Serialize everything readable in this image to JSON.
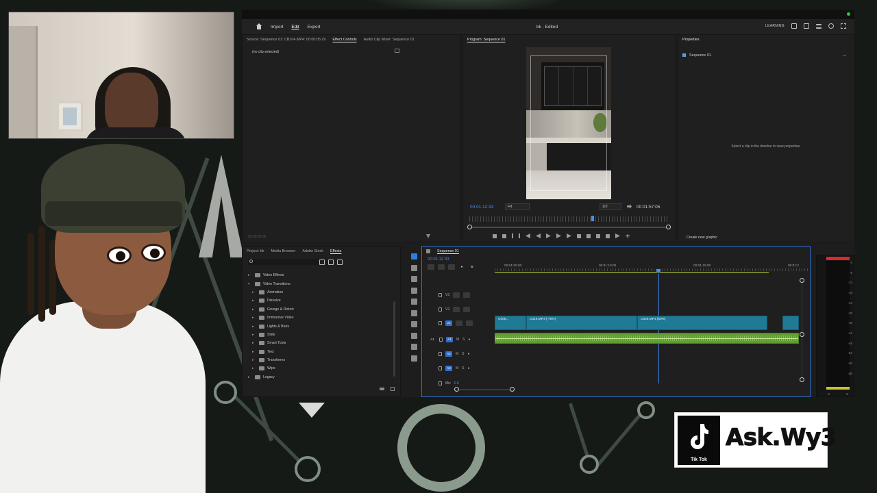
{
  "colors": {
    "accent": "#2d7de0",
    "video_clip": "#1f7a96",
    "audio_clip": "#5e9f2b",
    "timecode": "#4a8fe6",
    "meter_peak": "#e0262a"
  },
  "menubar": {
    "workspaces": [
      "Import",
      "Edit",
      "Export"
    ],
    "active_workspace": "Edit",
    "document_title": "bk - Edited",
    "learning_label": "LEARNING"
  },
  "source_panel": {
    "tabs": [
      "Source: Sequence 01: CB104.MP4: 00:00:05:29",
      "Effect Controls",
      "Audio Clip Mixer: Sequence 01"
    ],
    "active_tab": "Effect Controls",
    "empty_text": "(no clip selected)",
    "footer_timecode": "00:00:00:00"
  },
  "program_panel": {
    "tab": "Program: Sequence 01",
    "current_timecode": "00:01:12:33",
    "fit_option": "Fit",
    "resolution_option": "1/2",
    "duration_timecode": "00:01:57:05"
  },
  "properties_panel": {
    "tab": "Properties",
    "sequence_name": "Sequence 01",
    "hint": "Select a clip in the timeline to view properties.",
    "create_graphic_label": "Create new graphic"
  },
  "project_panel": {
    "tabs": [
      "Project: bk",
      "Media Browser",
      "Adobe Stock",
      "Effects"
    ],
    "active_tab": "Effects",
    "tree": [
      {
        "label": "Video Effects",
        "level": 0,
        "open": false
      },
      {
        "label": "Video Transitions",
        "level": 0,
        "open": true
      },
      {
        "label": "Animation",
        "level": 1
      },
      {
        "label": "Dissolve",
        "level": 1
      },
      {
        "label": "Grunge & Distort",
        "level": 1
      },
      {
        "label": "Immersive Video",
        "level": 1
      },
      {
        "label": "Lights & Blurs",
        "level": 1
      },
      {
        "label": "Slide",
        "level": 1
      },
      {
        "label": "Smart Tools",
        "level": 1
      },
      {
        "label": "Text",
        "level": 1
      },
      {
        "label": "Transforms",
        "level": 1
      },
      {
        "label": "Wipe",
        "level": 1
      },
      {
        "label": "Legacy",
        "level": 0
      }
    ]
  },
  "timeline": {
    "tab": "Sequence 01",
    "timecode": "00:01:12:33",
    "ruler_labels": [
      "00:01:05:00",
      "00:01:10:00",
      "00:01:15:00",
      "00:01:2"
    ],
    "tracks": [
      {
        "id": "V3",
        "type": "video"
      },
      {
        "id": "V2",
        "type": "video"
      },
      {
        "id": "V1",
        "type": "video"
      },
      {
        "id": "A1",
        "type": "audio"
      },
      {
        "id": "A2",
        "type": "audio"
      },
      {
        "id": "A3",
        "type": "audio"
      }
    ],
    "mix_label": "Mix",
    "mix_value": "0.0",
    "clips": [
      {
        "label": "C008...",
        "track": "V1"
      },
      {
        "label": "C016.MP4 [-75%]",
        "track": "V1"
      },
      {
        "label": "C028.MP4 [60%]",
        "track": "V1"
      }
    ]
  },
  "meter": {
    "scale": [
      "0",
      "-6",
      "-12",
      "-18",
      "-24",
      "-30",
      "-36",
      "-42",
      "-48",
      "-54",
      "-60",
      "dB"
    ],
    "channels": [
      "S",
      "S"
    ]
  },
  "overlay": {
    "brand_label": "Tik Tok",
    "handle": "Ask.Wy3"
  }
}
